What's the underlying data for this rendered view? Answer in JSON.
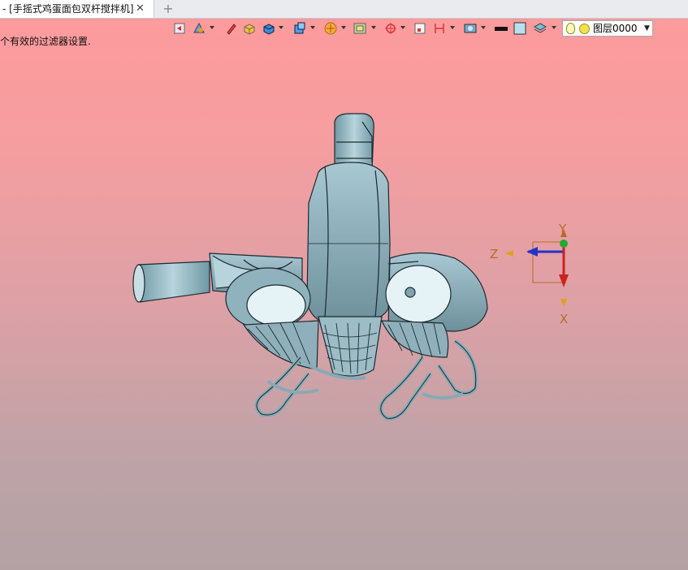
{
  "tabs": [
    {
      "label": "- [手摇式鸡蛋面包双杆搅拌机]",
      "close": "✕"
    }
  ],
  "new_tab": "+",
  "toolbar": {
    "layer_combo": {
      "value": "图层0000"
    }
  },
  "status_message": "个有效的过滤器设置.",
  "triad": {
    "x_label": "X",
    "y_label": "Y",
    "z_label": "Z"
  },
  "colors": {
    "background_top": "#ff9a9c",
    "background_bottom": "#b3a2a5",
    "model_fill": "#8fb3bd",
    "model_edge": "#1c2a30",
    "axis_x": "#cc2222",
    "axis_y": "#22aa33",
    "axis_z": "#2233cc"
  },
  "icons": [
    "undo-icon",
    "sketch-icon",
    "pencil-icon",
    "shaded-box-icon",
    "blue-cube-icon",
    "view-cube-icon",
    "render-style-icon",
    "section-icon",
    "snap-icon",
    "frame-icon",
    "measure-icon",
    "display-settings-icon",
    "line-color-icon",
    "fill-color-icon",
    "layers-icon",
    "bulb-icon",
    "layer-circle-icon"
  ]
}
